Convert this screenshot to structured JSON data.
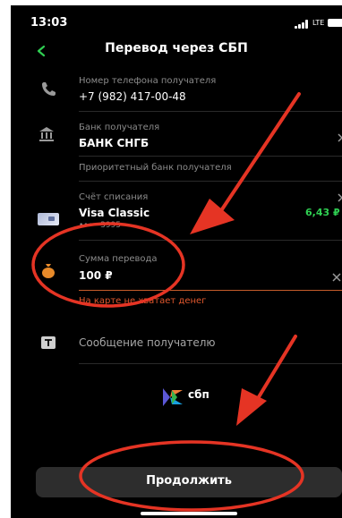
{
  "status_bar": {
    "time": "13:03",
    "network": "LTE"
  },
  "header": {
    "title": "Перевод через СБП"
  },
  "fields": {
    "phone": {
      "label": "Номер телефона получателя",
      "value": "+7 (982) 417-00-48"
    },
    "bank": {
      "label": "Банк получателя",
      "value": "БАНК СНГБ",
      "hint": "Приоритетный банк получателя"
    },
    "account": {
      "label": "Счёт списания",
      "card_name": "Visa Classic",
      "card_mask": "•••• 3995",
      "balance": "6,43 ₽"
    },
    "amount": {
      "label": "Сумма перевода",
      "value": "100 ₽",
      "error": "На карте не хватает денег"
    },
    "message": {
      "label": "Сообщение получателю"
    }
  },
  "sbp": {
    "logo_text": "сбп"
  },
  "footer": {
    "continue_label": "Продолжить"
  },
  "colors": {
    "background": "#000000",
    "accent_green": "#2fcf52",
    "error": "#e0572d",
    "annotation": "#e53424"
  },
  "icons": [
    "back-icon",
    "phone-icon",
    "bank-icon",
    "card-icon",
    "money-bag-icon",
    "message-icon",
    "clear-icon",
    "chevron-right-icon",
    "sbp-logo-icon"
  ]
}
